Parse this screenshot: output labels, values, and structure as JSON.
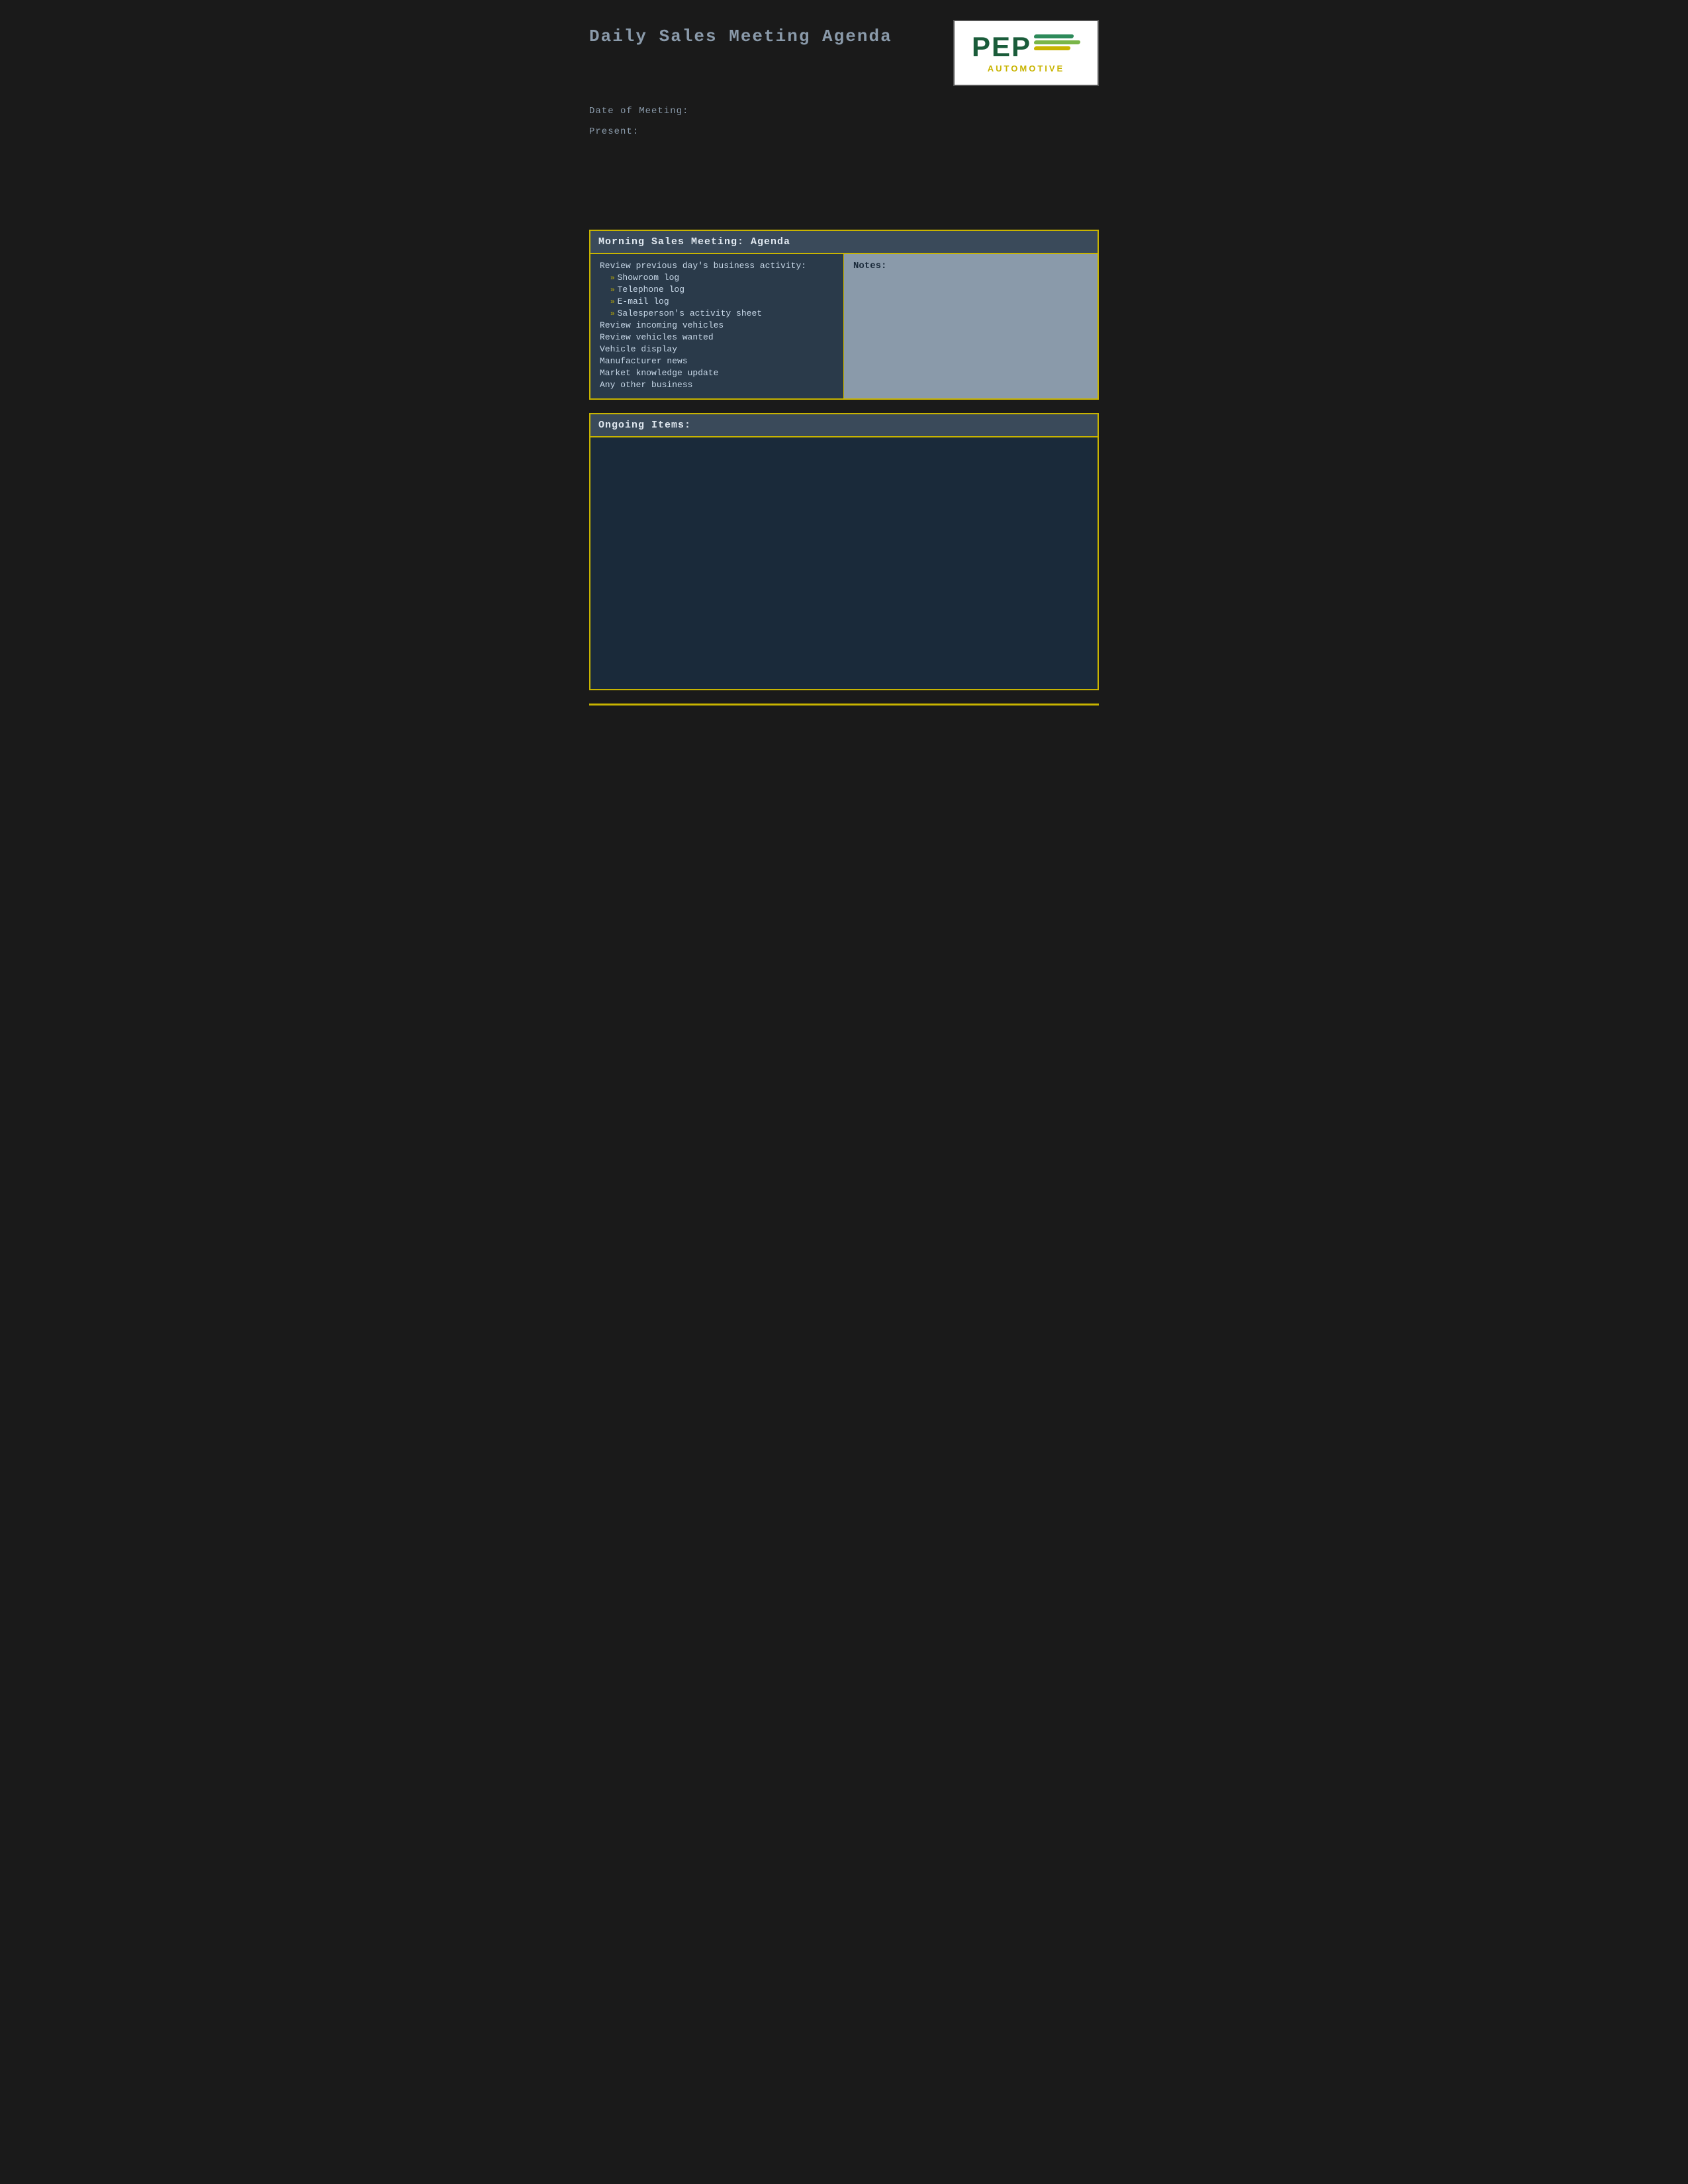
{
  "page": {
    "title": "Daily Sales Meeting Agenda",
    "background_color": "#1a1a1a"
  },
  "logo": {
    "pep_text": "PEP",
    "automotive_text": "AUTOMOTIVE"
  },
  "meta": {
    "date_label": "Date of Meeting:",
    "present_label": "Present:"
  },
  "morning_section": {
    "header": "Morning Sales Meeting: Agenda",
    "agenda_intro": "Review previous day's business activity:",
    "sub_items": [
      "Showroom log",
      "Telephone log",
      "E-mail log",
      "Salesperson's activity sheet"
    ],
    "main_items": [
      "Review incoming vehicles",
      "Review vehicles wanted",
      "Vehicle display",
      "Manufacturer news",
      "Market knowledge update",
      "Any other business"
    ],
    "notes_label": "Notes:"
  },
  "ongoing_section": {
    "header": "Ongoing Items:"
  }
}
